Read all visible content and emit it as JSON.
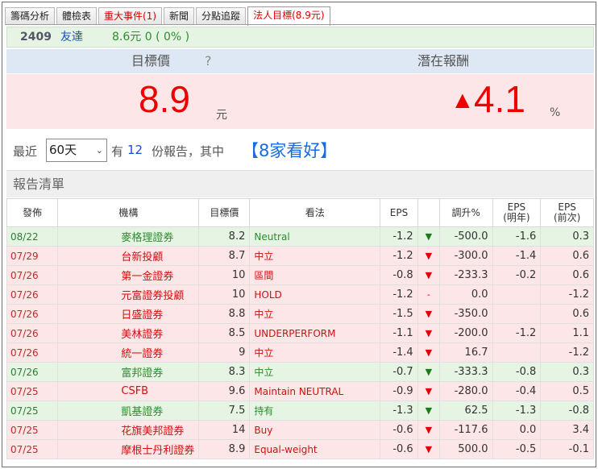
{
  "tabs": [
    "籌碼分析",
    "體檢表",
    "重大事件(1)",
    "新聞",
    "分點追蹤",
    "法人目標(8.9元)"
  ],
  "stock": {
    "code": "2409",
    "name": "友達",
    "price_change": "8.6元  0 ( 0% )"
  },
  "target": {
    "label": "目標價",
    "help": "?",
    "value": "8.9",
    "unit": "元",
    "upside_label": "潛在報酬",
    "upside_arrow": "▲",
    "upside": "4.1",
    "upside_unit": "%"
  },
  "filter": {
    "prefix": "最近",
    "period": "60天",
    "have": "有",
    "count": "12",
    "suffix": "份報告，其中",
    "summary": "【8家看好】"
  },
  "list_title": "報告清單",
  "columns": [
    "發佈",
    "機構",
    "目標價",
    "看法",
    "EPS",
    "",
    "調升%",
    "EPS\n(明年)",
    "EPS\n(前次)"
  ],
  "rows": [
    {
      "tone": "g",
      "date": "08/22",
      "firm": "麥格理證券",
      "target": "8.2",
      "view": "Neutral",
      "eps": "-1.2",
      "arrow": "▼",
      "chg": "-500.0",
      "eps_next": "-1.6",
      "eps_prev": "0.3"
    },
    {
      "tone": "r",
      "date": "07/29",
      "firm": "台新投顧",
      "target": "8.7",
      "view": "中立",
      "eps": "-1.2",
      "arrow": "▼",
      "chg": "-300.0",
      "eps_next": "-1.4",
      "eps_prev": "0.6"
    },
    {
      "tone": "r",
      "date": "07/26",
      "firm": "第一金證券",
      "target": "10",
      "view": "區間",
      "eps": "-0.8",
      "arrow": "▼",
      "chg": "-233.3",
      "eps_next": "-0.2",
      "eps_prev": "0.6"
    },
    {
      "tone": "r",
      "date": "07/26",
      "firm": "元富證券投顧",
      "target": "10",
      "view": "HOLD",
      "eps": "-1.2",
      "arrow": "-",
      "chg": "0.0",
      "eps_next": "",
      "eps_prev": "-1.2"
    },
    {
      "tone": "r",
      "date": "07/26",
      "firm": "日盛證券",
      "target": "8.8",
      "view": "中立",
      "eps": "-1.5",
      "arrow": "▼",
      "chg": "-350.0",
      "eps_next": "",
      "eps_prev": "0.6"
    },
    {
      "tone": "r",
      "date": "07/26",
      "firm": "美林證券",
      "target": "8.5",
      "view": "UNDERPERFORM",
      "eps": "-1.1",
      "arrow": "▼",
      "chg": "-200.0",
      "eps_next": "-1.2",
      "eps_prev": "1.1"
    },
    {
      "tone": "r",
      "date": "07/26",
      "firm": "統一證券",
      "target": "9",
      "view": "中立",
      "eps": "-1.4",
      "arrow": "▼",
      "chg": "16.7",
      "eps_next": "",
      "eps_prev": "-1.2"
    },
    {
      "tone": "g",
      "date": "07/26",
      "firm": "富邦證券",
      "target": "8.3",
      "view": "中立",
      "eps": "-0.7",
      "arrow": "▼",
      "chg": "-333.3",
      "eps_next": "-0.8",
      "eps_prev": "0.3"
    },
    {
      "tone": "r",
      "date": "07/25",
      "firm": "CSFB",
      "target": "9.6",
      "view": "Maintain NEUTRAL",
      "eps": "-0.9",
      "arrow": "▼",
      "chg": "-280.0",
      "eps_next": "-0.4",
      "eps_prev": "0.5"
    },
    {
      "tone": "g",
      "date": "07/25",
      "firm": "凱基證券",
      "target": "7.5",
      "view": "持有",
      "eps": "-1.3",
      "arrow": "▼",
      "chg": "62.5",
      "eps_next": "-1.3",
      "eps_prev": "-0.8"
    },
    {
      "tone": "r",
      "date": "07/25",
      "firm": "花旗美邦證券",
      "target": "14",
      "view": "Buy",
      "eps": "-0.6",
      "arrow": "▼",
      "chg": "-117.6",
      "eps_next": "0.0",
      "eps_prev": "3.4"
    },
    {
      "tone": "r",
      "date": "07/25",
      "firm": "摩根士丹利證券",
      "target": "8.9",
      "view": "Equal-weight",
      "eps": "-0.6",
      "arrow": "▼",
      "chg": "500.0",
      "eps_next": "-0.5",
      "eps_prev": "-0.1"
    }
  ]
}
